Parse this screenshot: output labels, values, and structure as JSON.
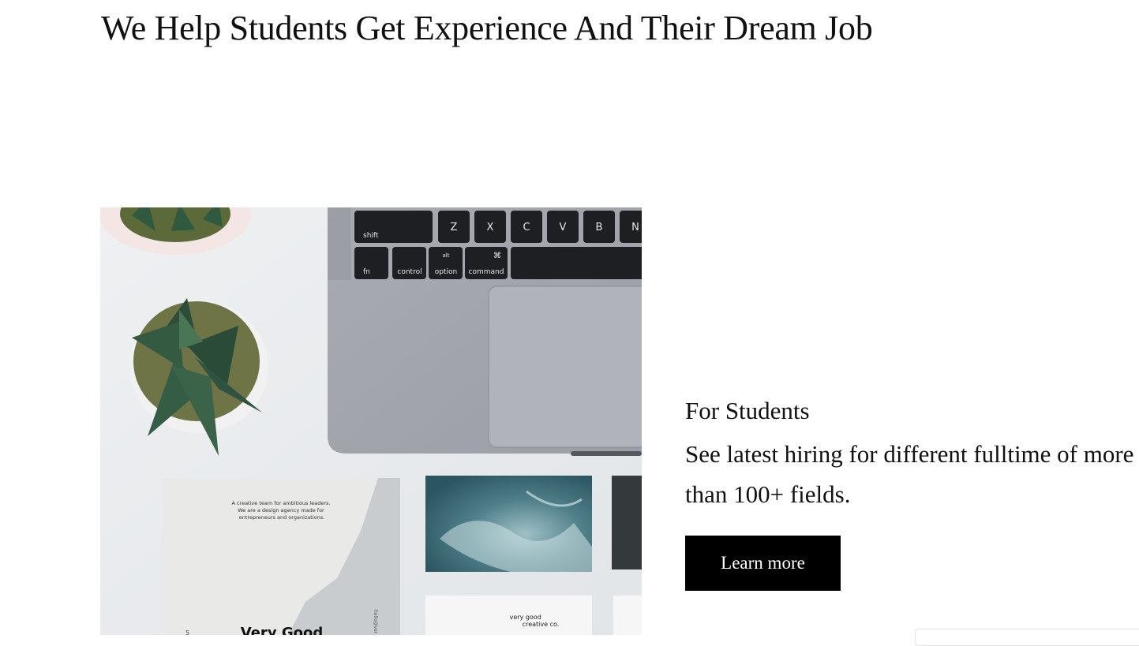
{
  "hero": {
    "title": "We Help Students Get Experience And Their Dream Job"
  },
  "image": {
    "icon": "workspace-photo",
    "keyboard": {
      "row1": [
        "shift",
        "Z",
        "X",
        "C",
        "V",
        "B",
        "N"
      ],
      "row2": [
        "fn",
        "control",
        "option",
        "command"
      ],
      "row2_top": [
        "",
        "",
        "alt",
        "⌘"
      ]
    },
    "card_text": {
      "tagline": [
        "A creative team for ambitious leaders.",
        "We are a design agency made for",
        "entrepreneurs and organizations."
      ],
      "brand_small": [
        "very good",
        "creative co."
      ],
      "brand_large": "Very Good",
      "side_text": "hello@ver",
      "page_num": "5"
    }
  },
  "for_students": {
    "title": "For Students",
    "description": "See latest hiring for different fulltime of more than 100+ fields.",
    "button_label": "Learn more"
  },
  "colors": {
    "background": "#ffffff",
    "text": "#111111",
    "button_bg": "#000000",
    "button_text": "#ffffff"
  }
}
